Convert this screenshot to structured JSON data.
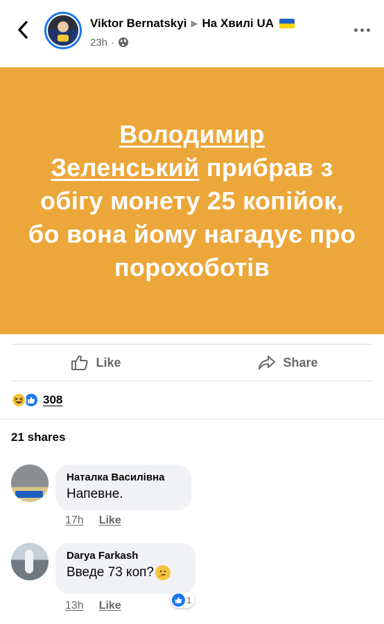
{
  "header": {
    "author": "Viktor Bernatskyi",
    "group": "На Хвилі UA",
    "time": "23h",
    "separator": "·"
  },
  "post": {
    "link_line_1": "Володимир",
    "link_line_2": "Зеленський",
    "text_rest": "прибрав з обігу монету 25 копійок, бо вона йому нагадує про порохоботів",
    "background_color": "#eca73a"
  },
  "actions": {
    "like_label": "Like",
    "share_label": "Share"
  },
  "reactions": {
    "count": "308",
    "icons": [
      "haha-icon",
      "like-icon"
    ]
  },
  "shares": "21 shares",
  "comments": [
    {
      "author": "Наталка Василівна",
      "text": "Напевне.",
      "time": "17h",
      "like_label": "Like"
    },
    {
      "author": "Darya Farkash",
      "text": "Введе 73 коп?",
      "time": "13h",
      "like_label": "Like",
      "reaction_count": "1"
    }
  ]
}
